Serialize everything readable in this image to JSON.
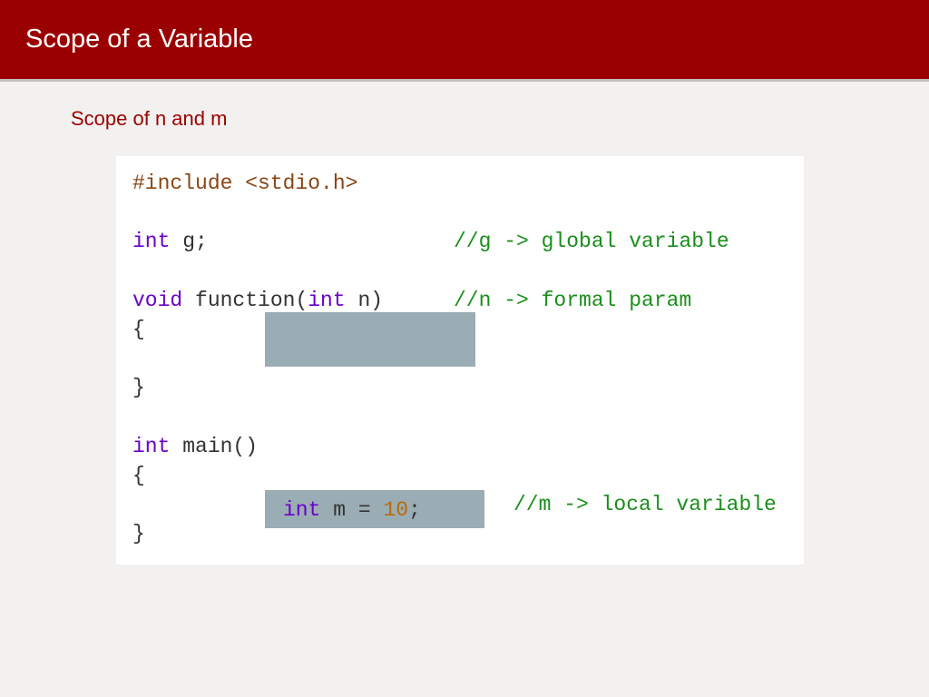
{
  "header": {
    "title": "Scope of a Variable"
  },
  "subtitle": "Scope of n and m",
  "code": {
    "line1_dir": "#include ",
    "line1_file": "<stdio.h>",
    "line3_type": "int",
    "line3_ident": " g;",
    "line3_comment": "//g -> global variable",
    "line5_void": "void",
    "line5_ident": " function(",
    "line5_paramtype": "int",
    "line5_paramname": " n)",
    "line5_comment": "//n -> formal param",
    "line6_brace_open": "{",
    "line8_brace_close": "}",
    "line10_type": "int",
    "line10_ident": " main()",
    "line11_brace_open": "{",
    "line12_indent": "    ",
    "line12_type": "int",
    "line12_ident": " m ",
    "line12_op": "= ",
    "line12_num": "10",
    "line12_semi": ";",
    "line12_comment": "//m -> local variable",
    "line13_brace_close": "}"
  }
}
